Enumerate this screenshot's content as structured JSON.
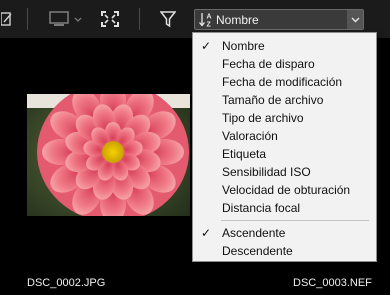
{
  "toolbar": {
    "icons": [
      "edit-icon",
      "monitor-icon",
      "fullscreen-icon",
      "filter-icon"
    ],
    "sort_combo": {
      "selected": "Nombre",
      "icon": "sort-az-icon"
    }
  },
  "thumbnails": [
    {
      "filename": "DSC_0002.JPG"
    },
    {
      "filename": "DSC_0003.NEF"
    }
  ],
  "sort_menu": {
    "items": [
      {
        "label": "Nombre",
        "checked": true
      },
      {
        "label": "Fecha de disparo",
        "checked": false
      },
      {
        "label": "Fecha de modificación",
        "checked": false
      },
      {
        "label": "Tamaño de archivo",
        "checked": false
      },
      {
        "label": "Tipo de archivo",
        "checked": false
      },
      {
        "label": "Valoración",
        "checked": false
      },
      {
        "label": "Etiqueta",
        "checked": false
      },
      {
        "label": "Sensibilidad ISO",
        "checked": false
      },
      {
        "label": "Velocidad de obturación",
        "checked": false
      },
      {
        "label": "Distancia focal",
        "checked": false
      }
    ],
    "order_items": [
      {
        "label": "Ascendente",
        "checked": true
      },
      {
        "label": "Descendente",
        "checked": false
      }
    ],
    "check_glyph": "✓"
  }
}
